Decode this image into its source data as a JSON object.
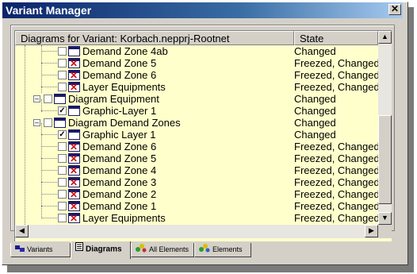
{
  "window": {
    "title": "Variant Manager",
    "close_glyph": "✕"
  },
  "list": {
    "columns": [
      "Diagrams for Variant: Korbach.nepprj-Rootnet",
      "State"
    ],
    "rows": [
      {
        "name": "Demand Zone 4ab",
        "state": "Changed",
        "checked": false,
        "icon": "diagram-icon"
      },
      {
        "name": "Demand Zone 5",
        "state": "Freezed, Changed",
        "checked": false,
        "icon": "frozen-diagram-icon"
      },
      {
        "name": "Demand Zone 6",
        "state": "Freezed, Changed",
        "checked": false,
        "icon": "frozen-diagram-icon"
      },
      {
        "name": "Layer Equipments",
        "state": "Freezed, Changed",
        "checked": false,
        "icon": "frozen-diagram-icon"
      },
      {
        "name": "Diagram Equipment",
        "state": "Changed",
        "checked": false,
        "icon": "diagram-icon"
      },
      {
        "name": "Graphic-Layer 1",
        "state": "Changed",
        "checked": true,
        "icon": "diagram-icon"
      },
      {
        "name": "Diagram Demand Zones",
        "state": "Changed",
        "checked": false,
        "icon": "diagram-icon"
      },
      {
        "name": "Graphic Layer 1",
        "state": "Changed",
        "checked": true,
        "icon": "diagram-icon"
      },
      {
        "name": "Demand Zone 6",
        "state": "Freezed, Changed",
        "checked": false,
        "icon": "frozen-diagram-icon"
      },
      {
        "name": "Demand Zone 5",
        "state": "Freezed, Changed",
        "checked": false,
        "icon": "frozen-diagram-icon"
      },
      {
        "name": "Demand Zone 4",
        "state": "Freezed, Changed",
        "checked": false,
        "icon": "frozen-diagram-icon"
      },
      {
        "name": "Demand Zone 3",
        "state": "Freezed, Changed",
        "checked": false,
        "icon": "frozen-diagram-icon"
      },
      {
        "name": "Demand Zone 2",
        "state": "Freezed, Changed",
        "checked": false,
        "icon": "frozen-diagram-icon"
      },
      {
        "name": "Demand Zone 1",
        "state": "Freezed, Changed",
        "checked": false,
        "icon": "frozen-diagram-icon"
      },
      {
        "name": "Layer Equipments",
        "state": "Freezed, Changed",
        "checked": false,
        "icon": "frozen-diagram-icon"
      }
    ]
  },
  "tabs": [
    {
      "label": "Variants",
      "active": false,
      "icon": "variants-icon"
    },
    {
      "label": "Diagrams",
      "active": true,
      "icon": "diagrams-icon"
    },
    {
      "label": "All Elements",
      "active": false,
      "icon": "all-elements-icon"
    },
    {
      "label": "Elements",
      "active": false,
      "icon": "elements-icon"
    }
  ],
  "colors": {
    "list_background": "#ffffcc",
    "title_bar": "#0a246a",
    "frozen_mark": "#d01010"
  }
}
